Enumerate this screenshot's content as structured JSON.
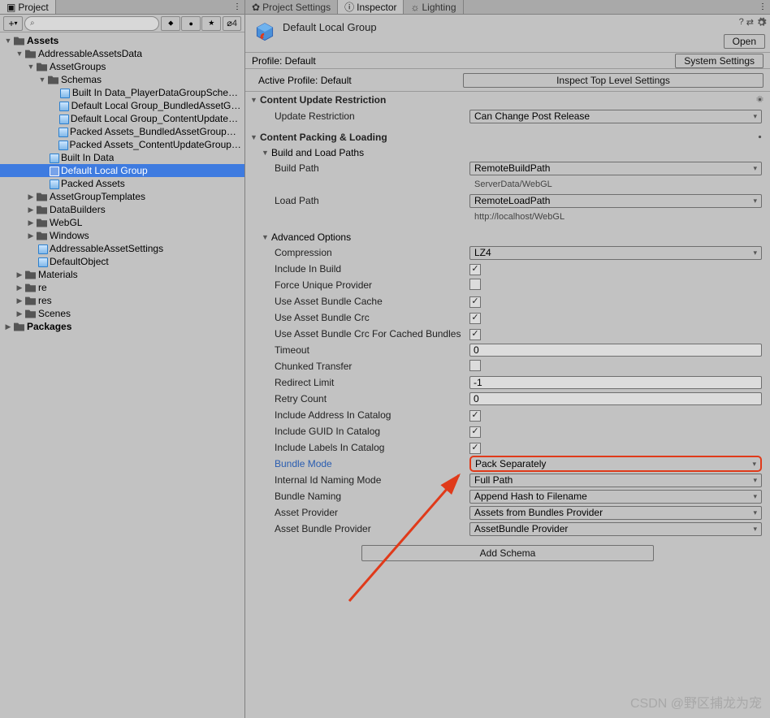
{
  "leftPanel": {
    "tab": "Project",
    "search_placeholder": "",
    "hiddenCount": "4",
    "tree": [
      {
        "d": 0,
        "t": "Assets",
        "f": "open",
        "ic": "folder",
        "bold": true
      },
      {
        "d": 1,
        "t": "AddressableAssetsData",
        "f": "open",
        "ic": "folder"
      },
      {
        "d": 2,
        "t": "AssetGroups",
        "f": "open",
        "ic": "folder"
      },
      {
        "d": 3,
        "t": "Schemas",
        "f": "open",
        "ic": "folder"
      },
      {
        "d": 4,
        "t": "Built In Data_PlayerDataGroupSchema",
        "ic": "box"
      },
      {
        "d": 4,
        "t": "Default Local Group_BundledAssetGroup",
        "ic": "box"
      },
      {
        "d": 4,
        "t": "Default Local Group_ContentUpdateGroup",
        "ic": "box"
      },
      {
        "d": 4,
        "t": "Packed Assets_BundledAssetGroupSchema",
        "ic": "box"
      },
      {
        "d": 4,
        "t": "Packed Assets_ContentUpdateGroupSchema",
        "ic": "box"
      },
      {
        "d": 3,
        "t": "Built In Data",
        "ic": "box"
      },
      {
        "d": 3,
        "t": "Default Local Group",
        "ic": "box",
        "sel": true
      },
      {
        "d": 3,
        "t": "Packed Assets",
        "ic": "box"
      },
      {
        "d": 2,
        "t": "AssetGroupTemplates",
        "f": "closed",
        "ic": "folder"
      },
      {
        "d": 2,
        "t": "DataBuilders",
        "f": "closed",
        "ic": "folder"
      },
      {
        "d": 2,
        "t": "WebGL",
        "f": "closed",
        "ic": "folder"
      },
      {
        "d": 2,
        "t": "Windows",
        "f": "closed",
        "ic": "folder"
      },
      {
        "d": 2,
        "t": "AddressableAssetSettings",
        "ic": "box"
      },
      {
        "d": 2,
        "t": "DefaultObject",
        "ic": "box"
      },
      {
        "d": 1,
        "t": "Materials",
        "f": "closed",
        "ic": "folder"
      },
      {
        "d": 1,
        "t": "re",
        "f": "closed",
        "ic": "folder"
      },
      {
        "d": 1,
        "t": "res",
        "f": "closed",
        "ic": "folder"
      },
      {
        "d": 1,
        "t": "Scenes",
        "f": "closed",
        "ic": "folder"
      },
      {
        "d": 0,
        "t": "Packages",
        "f": "closed",
        "ic": "folder",
        "bold": true
      }
    ]
  },
  "rightPanel": {
    "tabs": [
      "Project Settings",
      "Inspector",
      "Lighting"
    ],
    "activeTab": 1,
    "title": "Default Local Group",
    "openBtn": "Open",
    "profileRow": {
      "label": "Profile: Default",
      "btn": "System Settings"
    },
    "activeProfileRow": {
      "label": "Active Profile: Default",
      "btn": "Inspect Top Level Settings"
    },
    "sections": {
      "cur": {
        "title": "Content Update Restriction",
        "fields": [
          {
            "label": "Update Restriction",
            "type": "dd",
            "value": "Can Change Post Release"
          }
        ]
      },
      "cpl": {
        "title": "Content Packing & Loading",
        "sub1": "Build and Load Paths",
        "buildPath": {
          "label": "Build Path",
          "value": "RemoteBuildPath",
          "info": "ServerData/WebGL"
        },
        "loadPath": {
          "label": "Load Path",
          "value": "RemoteLoadPath",
          "info": "http://localhost/WebGL"
        },
        "sub2": "Advanced Options",
        "adv": [
          {
            "label": "Compression",
            "type": "dd",
            "value": "LZ4"
          },
          {
            "label": "Include In Build",
            "type": "chk",
            "value": true
          },
          {
            "label": "Force Unique Provider",
            "type": "chk",
            "value": false
          },
          {
            "label": "Use Asset Bundle Cache",
            "type": "chk",
            "value": true
          },
          {
            "label": "Use Asset Bundle Crc",
            "type": "chk",
            "value": true
          },
          {
            "label": "Use Asset Bundle Crc For Cached Bundles",
            "type": "chk",
            "value": true
          },
          {
            "label": "Timeout",
            "type": "txt",
            "value": "0"
          },
          {
            "label": "Chunked Transfer",
            "type": "chk",
            "value": false
          },
          {
            "label": "Redirect Limit",
            "type": "txt",
            "value": "-1"
          },
          {
            "label": "Retry Count",
            "type": "txt",
            "value": "0"
          },
          {
            "label": "Include Address In Catalog",
            "type": "chk",
            "value": true
          },
          {
            "label": "Include GUID In Catalog",
            "type": "chk",
            "value": true
          },
          {
            "label": "Include Labels In Catalog",
            "type": "chk",
            "value": true
          },
          {
            "label": "Bundle Mode",
            "type": "dd",
            "value": "Pack Separately",
            "hl": true
          },
          {
            "label": "Internal Id Naming Mode",
            "type": "dd",
            "value": "Full Path"
          },
          {
            "label": "Bundle Naming",
            "type": "dd",
            "value": "Append Hash to Filename"
          },
          {
            "label": "Asset Provider",
            "type": "dd",
            "value": "Assets from Bundles Provider"
          },
          {
            "label": "Asset Bundle Provider",
            "type": "dd",
            "value": "AssetBundle Provider"
          }
        ]
      }
    },
    "addSchema": "Add Schema"
  },
  "watermark": "CSDN @野区捕龙为宠"
}
